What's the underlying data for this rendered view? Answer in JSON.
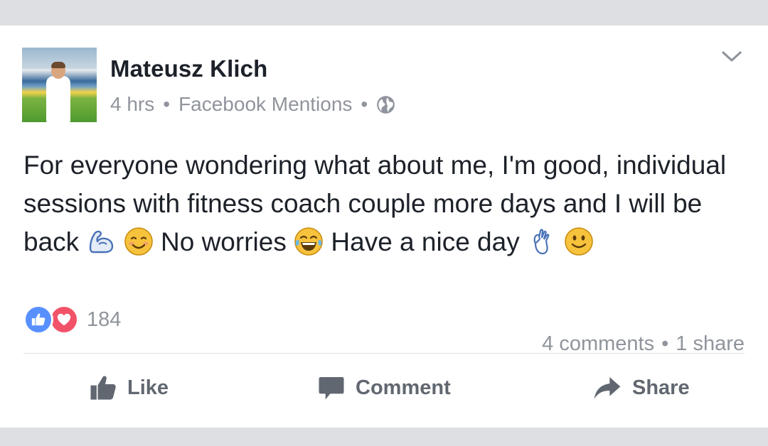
{
  "post": {
    "author": "Mateusz Klich",
    "time": "4 hrs",
    "separator": "•",
    "source": "Facebook Mentions",
    "privacy_icon": "globe-icon",
    "text": {
      "line_a": "For everyone wondering what about me, I'm good, individual sessions with fitness coach couple more days and I will be back",
      "line_b": "No worries",
      "line_c": "Have a nice day"
    },
    "emojis": [
      "flexed-biceps-icon",
      "smiling-face-icon",
      "tears-of-joy-icon",
      "ok-hand-icon",
      "slightly-smiling-face-icon"
    ]
  },
  "reactions": {
    "icons": [
      "like-reaction-icon",
      "love-reaction-icon"
    ],
    "count": "184",
    "comments": "4 comments",
    "shares": "1 share",
    "like_color": "#5890ff",
    "love_color": "#f25268"
  },
  "actions": {
    "like": "Like",
    "comment": "Comment",
    "share": "Share"
  },
  "colors": {
    "background": "#dddfe2",
    "card": "#ffffff",
    "text": "#1d2129",
    "muted": "#90949c",
    "action_text": "#616770"
  }
}
